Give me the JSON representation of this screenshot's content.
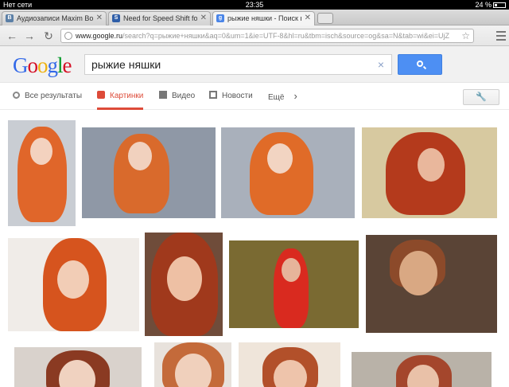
{
  "status_bar": {
    "carrier": "Нет сети",
    "time": "23:35",
    "battery": "24 %"
  },
  "tabs": [
    {
      "title": "Аудиозаписи Maxim Bogd...",
      "favicon": "В",
      "favicon_color": "#5b7fa6",
      "active": false
    },
    {
      "title": "Need for Speed Shift for iPa",
      "favicon": "S",
      "favicon_color": "#2f5ea8",
      "active": false
    },
    {
      "title": "рыжие няшки - Поиск в G...",
      "favicon": "g",
      "favicon_color": "#4a85e8",
      "active": true
    }
  ],
  "toolbar": {
    "url_domain": "www.google.ru",
    "url_rest": "/search?q=рыжие+няшки&aq=0&um=1&ie=UTF-8&hl=ru&tbm=isch&source=og&sa=N&tab=wi&ei=UjZ",
    "back_icon": "back-arrow-icon",
    "forward_icon": "forward-arrow-icon",
    "reload_icon": "reload-icon"
  },
  "search": {
    "logo": "Google",
    "query": "рыжие няшки",
    "clear": "×"
  },
  "nav": {
    "all": "Все результаты",
    "images": "Картинки",
    "video": "Видео",
    "news": "Новости",
    "more": "Ещё",
    "more_arrow": "›"
  },
  "colors": {
    "accent_red": "#dd4b39",
    "search_blue": "#4d8ff3"
  },
  "results": [
    {
      "desc": "redhead-1",
      "bg": "#c9cdd3",
      "hair": "#e0662a"
    },
    {
      "desc": "redhead-2",
      "bg": "#8f98a6",
      "hair": "#d96a2c"
    },
    {
      "desc": "redhead-3",
      "bg": "#a9b0bb",
      "hair": "#e06b28"
    },
    {
      "desc": "redhead-4",
      "bg": "#d7c9a0",
      "hair": "#b43a1c"
    },
    {
      "desc": "redhead-5",
      "bg": "#f0ece8",
      "hair": "#d6541e"
    },
    {
      "desc": "redhead-6",
      "bg": "#6f4c3a",
      "hair": "#a0391c"
    },
    {
      "desc": "redhead-7",
      "bg": "#7a6a32",
      "hair": "#d92a1f"
    },
    {
      "desc": "man-1",
      "bg": "#5a4436",
      "hair": "#8c4a2a"
    },
    {
      "desc": "redhead-8",
      "bg": "#d9d2cc",
      "hair": "#8a3a22"
    },
    {
      "desc": "redhead-9",
      "bg": "#e8e2dc",
      "hair": "#c46a3a"
    },
    {
      "desc": "redhead-10",
      "bg": "#efe5da",
      "hair": "#b2502a"
    },
    {
      "desc": "redhead-11",
      "bg": "#b9b2a8",
      "hair": "#a4462c"
    }
  ]
}
